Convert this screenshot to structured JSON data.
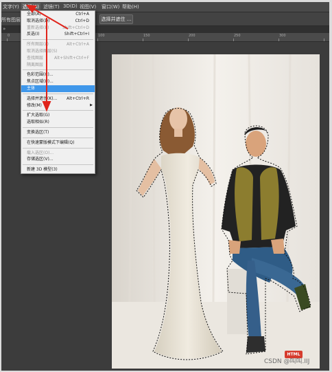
{
  "menubar": {
    "items": [
      "文字(Y)",
      "选择(S)",
      "滤镜(T)",
      "3D(D)",
      "视图(V)",
      "窗口(W)",
      "帮助(H)"
    ]
  },
  "options_bar": {
    "label": "所有图层取",
    "select_and_mask_button": "选择并遮住 ..."
  },
  "tabs": {
    "close_glyph": "»"
  },
  "ruler": {
    "labels": [
      "0",
      "50",
      "100",
      "150",
      "200",
      "250",
      "300",
      "350",
      "400"
    ]
  },
  "select_menu": {
    "items": [
      {
        "label": "全部(A)",
        "shortcut": "Ctrl+A",
        "disabled": false
      },
      {
        "label": "取消选择(D)",
        "shortcut": "Ctrl+D",
        "disabled": false
      },
      {
        "label": "重新选择(E)",
        "shortcut": "Shift+Ctrl+D",
        "disabled": true
      },
      {
        "label": "反选(I)",
        "shortcut": "Shift+Ctrl+I",
        "disabled": false
      },
      {
        "sep": true
      },
      {
        "label": "所有图层(L)",
        "shortcut": "Alt+Ctrl+A",
        "disabled": true
      },
      {
        "label": "取消选择图层(S)",
        "shortcut": "",
        "disabled": true
      },
      {
        "label": "查找图层",
        "shortcut": "Alt+Shift+Ctrl+F",
        "disabled": true
      },
      {
        "label": "隔离图层",
        "shortcut": "",
        "disabled": true
      },
      {
        "sep": true
      },
      {
        "label": "色彩范围(C)...",
        "shortcut": "",
        "disabled": false
      },
      {
        "label": "焦点区域(U)...",
        "shortcut": "",
        "disabled": false
      },
      {
        "label": "主体",
        "shortcut": "",
        "disabled": false,
        "highlighted": true
      },
      {
        "sep": true
      },
      {
        "label": "选择并遮住(K)...",
        "shortcut": "Alt+Ctrl+R",
        "disabled": false
      },
      {
        "label": "修改(M)",
        "shortcut": "",
        "disabled": false,
        "submenu": true
      },
      {
        "sep": true
      },
      {
        "label": "扩大选取(G)",
        "shortcut": "",
        "disabled": false
      },
      {
        "label": "选取相似(R)",
        "shortcut": "",
        "disabled": false
      },
      {
        "sep": true
      },
      {
        "label": "变换选区(T)",
        "shortcut": "",
        "disabled": false
      },
      {
        "sep": true
      },
      {
        "label": "在快速蒙版模式下编辑(Q)",
        "shortcut": "",
        "disabled": false
      },
      {
        "sep": true
      },
      {
        "label": "载入选区(O)...",
        "shortcut": "",
        "disabled": true
      },
      {
        "label": "存储选区(V)...",
        "shortcut": "",
        "disabled": false
      },
      {
        "sep": true
      },
      {
        "label": "新建 3D 模型(3)",
        "shortcut": "",
        "disabled": false
      }
    ]
  },
  "watermark": {
    "badge": "HTML",
    "text": "CSDN @叫叫.IIJ"
  },
  "colors": {
    "highlight": "#3f97ea",
    "arrow": "#e0241b"
  }
}
